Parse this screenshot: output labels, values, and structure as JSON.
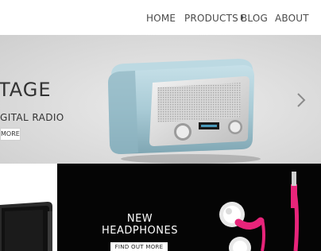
{
  "nav": {
    "home": "HOME",
    "products": "PRODUCTS",
    "blog": "BLOG",
    "about": "ABOUT"
  },
  "hero": {
    "title": "TAGE",
    "subtitle": "GITAL RADIO",
    "button_label": "MORE",
    "next_icon": "chevron-right-icon"
  },
  "promo": {
    "title_line1": "NEW",
    "title_line2": "HEADPHONES",
    "button_label": "FIND OUT MORE"
  },
  "colors": {
    "nav_text": "#4a4a4a",
    "promo_background": "#050505",
    "headphone_pink": "#e8247a",
    "radio_blue": "#a9cbd6"
  }
}
